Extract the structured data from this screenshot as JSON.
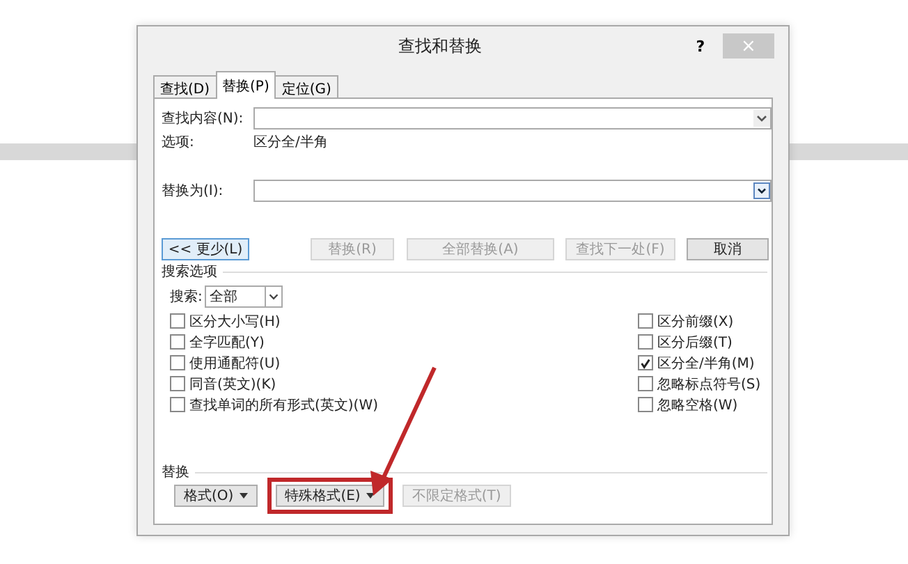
{
  "window": {
    "title": "查找和替换",
    "help": "?",
    "close": "×"
  },
  "tabs": [
    {
      "label": "查找(D)",
      "selected": false
    },
    {
      "label": "替换(P)",
      "selected": true
    },
    {
      "label": "定位(G)",
      "selected": false
    }
  ],
  "find": {
    "label": "查找内容(N):",
    "options_label": "选项:",
    "options_value": "区分全/半角"
  },
  "replace": {
    "label": "替换为(I):"
  },
  "buttons": [
    {
      "label": "<< 更少(L)",
      "disabled": false
    },
    {
      "label": "替换(R)",
      "disabled": true
    },
    {
      "label": "全部替换(A)",
      "disabled": true
    },
    {
      "label": "查找下一处(F)",
      "disabled": true
    },
    {
      "label": "取消",
      "disabled": false
    }
  ],
  "search_options": {
    "title": "搜索选项",
    "search_label": "搜索:",
    "search_value": "全部",
    "left": [
      {
        "label": "区分大小写(H)",
        "checked": false
      },
      {
        "label": "全字匹配(Y)",
        "checked": false
      },
      {
        "label": "使用通配符(U)",
        "checked": false
      },
      {
        "label": "同音(英文)(K)",
        "checked": false
      },
      {
        "label": "查找单词的所有形式(英文)(W)",
        "checked": false
      }
    ],
    "right": [
      {
        "label": "区分前缀(X)",
        "checked": false
      },
      {
        "label": "区分后缀(T)",
        "checked": false
      },
      {
        "label": "区分全/半角(M)",
        "checked": true
      },
      {
        "label": "忽略标点符号(S)",
        "checked": false
      },
      {
        "label": "忽略空格(W)",
        "checked": false
      }
    ]
  },
  "replace_section": {
    "title": "替换",
    "buttons": [
      {
        "label": "格式(O)",
        "dropdown": true,
        "disabled": false,
        "highlighted": false
      },
      {
        "label": "特殊格式(E)",
        "dropdown": true,
        "disabled": false,
        "highlighted": true
      },
      {
        "label": "不限定格式(T)",
        "dropdown": false,
        "disabled": true,
        "highlighted": false
      }
    ]
  }
}
